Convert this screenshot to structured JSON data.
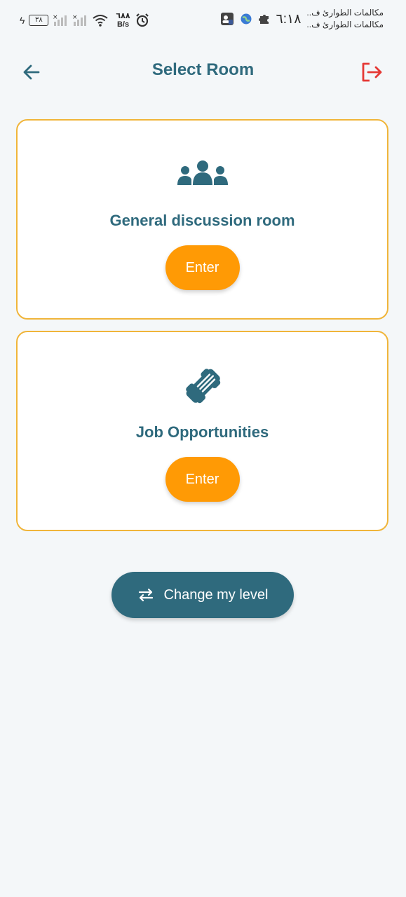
{
  "status_bar": {
    "battery_level": "٣٨",
    "net_speed_value": "٦٨٨",
    "net_speed_unit": "B/s",
    "time": "٦:١٨",
    "notification_1": "مكالمات الطوارئ ف..",
    "notification_2": "مكالمات الطوارئ ف.."
  },
  "app_bar": {
    "title": "Select Room"
  },
  "rooms": [
    {
      "name": "General discussion room",
      "icon": "group-icon",
      "enter_label": "Enter"
    },
    {
      "name": "Job Opportunities",
      "icon": "handshake-icon",
      "enter_label": "Enter"
    }
  ],
  "change_level": {
    "label": "Change my level",
    "icon": "swap-icon"
  },
  "colors": {
    "primary": "#2f6a7d",
    "accent": "#ff9a05",
    "card_border": "#f0b53a",
    "logout": "#e53935",
    "background": "#f4f7f9"
  }
}
